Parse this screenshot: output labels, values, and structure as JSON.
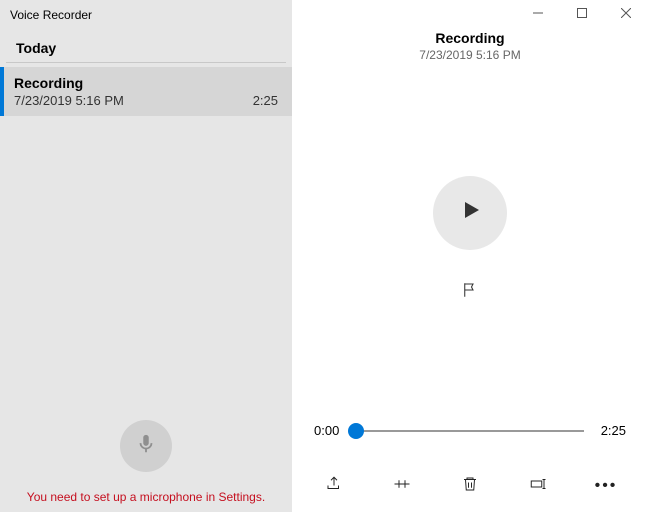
{
  "app": {
    "title": "Voice Recorder"
  },
  "sidebar": {
    "section_label": "Today",
    "warning": "You need to set up a microphone in Settings.",
    "items": [
      {
        "title": "Recording",
        "timestamp": "7/23/2019 5:16 PM",
        "duration": "2:25"
      }
    ]
  },
  "detail": {
    "title": "Recording",
    "timestamp": "7/23/2019 5:16 PM",
    "elapsed": "0:00",
    "total": "2:25"
  }
}
